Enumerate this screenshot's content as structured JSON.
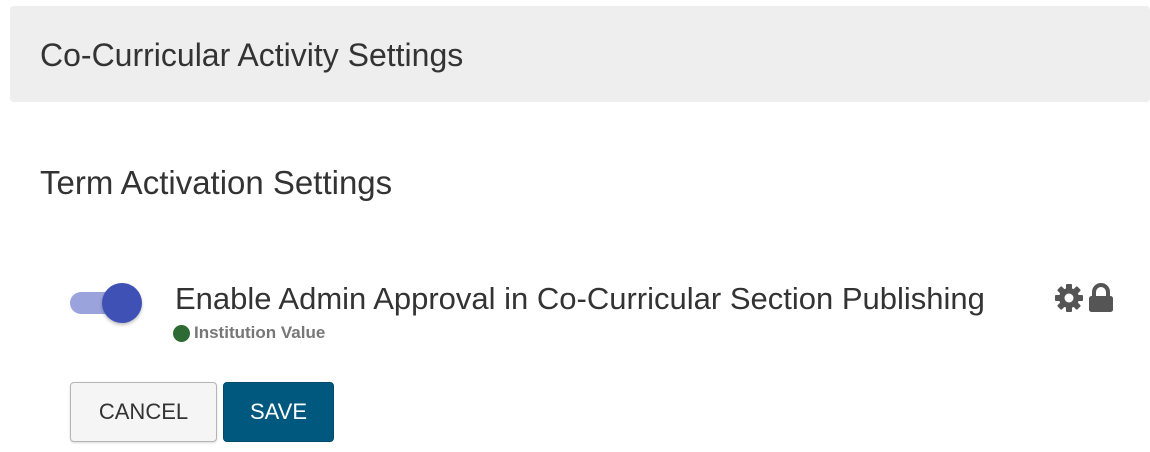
{
  "header": {
    "title": "Co-Curricular Activity Settings"
  },
  "section": {
    "title": "Term Activation Settings"
  },
  "setting": {
    "label": "Enable Admin Approval in Co-Curricular Section Publishing",
    "enabled": true,
    "status_text": "Institution Value",
    "status_color": "#2e6b34",
    "icons": [
      "gear-icon",
      "lock-icon"
    ]
  },
  "actions": {
    "cancel_label": "CANCEL",
    "save_label": "SAVE"
  },
  "colors": {
    "header_bg": "#eeeeee",
    "toggle_knob": "#3f51b5",
    "toggle_track": "#9ba3dd",
    "save_bg": "#00587f",
    "icon": "#555555"
  }
}
